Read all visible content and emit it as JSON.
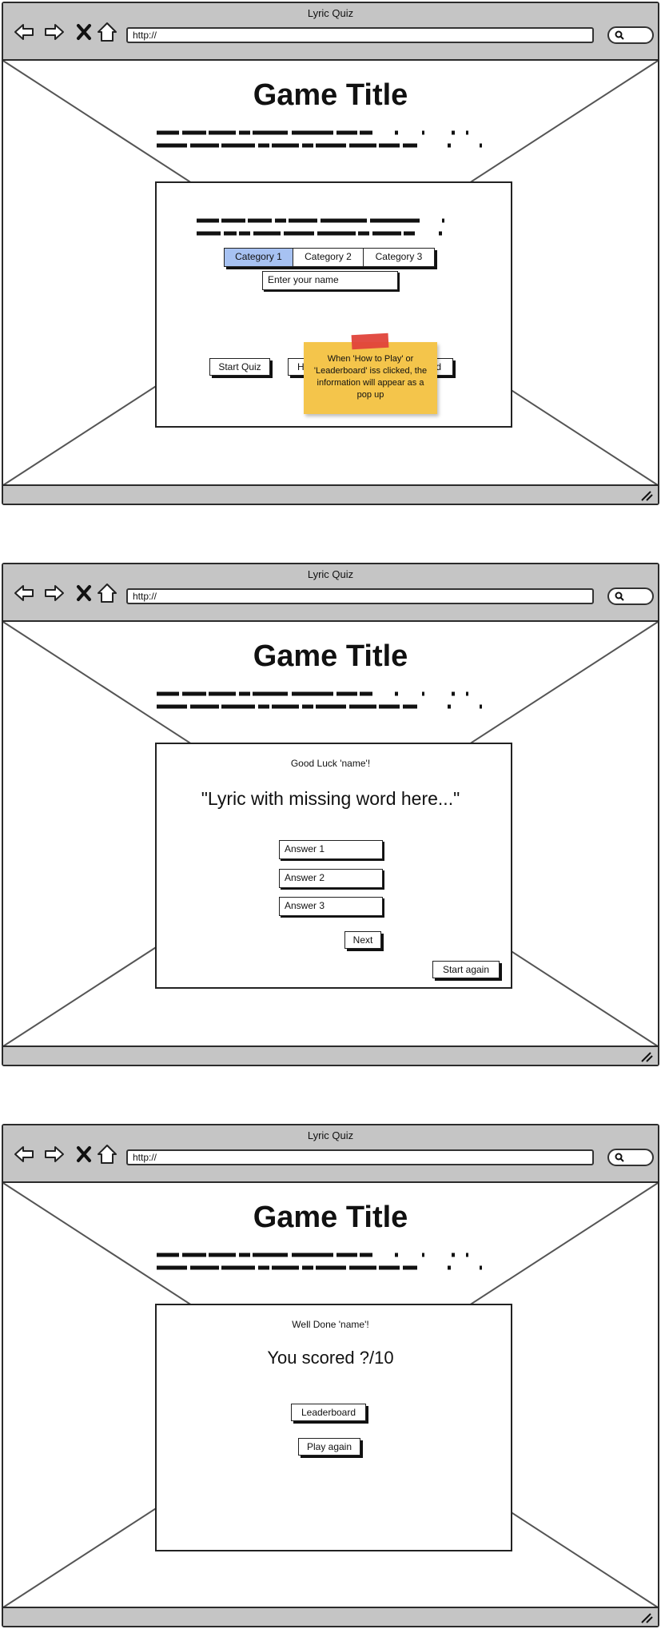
{
  "browser": {
    "window_title": "Lyric Quiz",
    "url": "http://"
  },
  "screen1": {
    "game_title": "Game Title",
    "name_input_placeholder": "Enter your name",
    "categories": [
      "Category 1",
      "Category 2",
      "Category 3"
    ],
    "active_category_index": 0,
    "buttons": {
      "start_quiz": "Start Quiz",
      "how_to_play": "How to Play",
      "leaderboard": "Leaderboard"
    },
    "sticky_note": "When 'How to Play' or 'Leaderboard' iss clicked, the information will appear as a pop up"
  },
  "screen2": {
    "game_title": "Game Title",
    "greeting": "Good Luck 'name'!",
    "lyric": "\"Lyric with missing word here...\"",
    "answers": [
      "Answer 1",
      "Answer 2",
      "Answer 3"
    ],
    "next_label": "Next",
    "start_again_label": "Start again"
  },
  "screen3": {
    "game_title": "Game Title",
    "greeting": "Well Done 'name'!",
    "score_text": "You scored ?/10",
    "leaderboard_label": "Leaderboard",
    "play_again_label": "Play again"
  },
  "colors": {
    "chrome": "#c5c5c5",
    "active_tab": "#a7c2f2",
    "sticky_note": "#f4c54b",
    "tape": "#e0433a"
  }
}
